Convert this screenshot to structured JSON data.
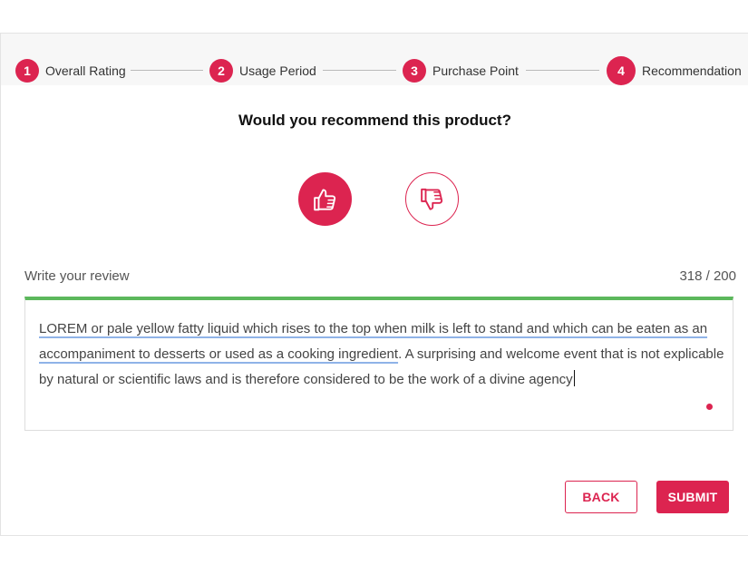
{
  "stepper": {
    "steps": [
      {
        "number": "1",
        "label": "Overall Rating"
      },
      {
        "number": "2",
        "label": "Usage Period"
      },
      {
        "number": "3",
        "label": "Purchase Point"
      },
      {
        "number": "4",
        "label": "Recommendation"
      }
    ]
  },
  "main": {
    "question": "Would you recommend this product?",
    "thumbs_up_icon": "thumbs-up-icon",
    "thumbs_down_icon": "thumbs-down-icon",
    "selected_vote": "up"
  },
  "review": {
    "label": "Write your review",
    "counter": "318 / 200",
    "text_part1": "LOREM or pale yellow fatty liquid which rises to the top when milk is left to stand and which can be eaten as an accompaniment to desserts or used as a cooking ingredient",
    "text_part2": ". A surprising and welcome event that is not explicable by natural or scientific laws and is therefore considered to be the work of a divine agency"
  },
  "actions": {
    "back_label": "BACK",
    "submit_label": "SUBMIT"
  },
  "colors": {
    "accent": "#dc2450",
    "valid_border": "#5cb85c"
  }
}
